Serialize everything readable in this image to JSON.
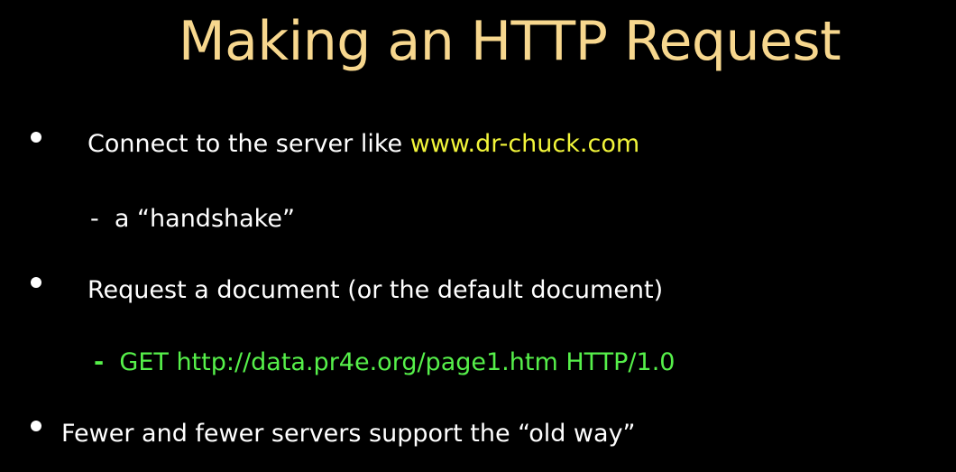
{
  "colors": {
    "background": "#000000",
    "title": "#f7d78e",
    "text": "#ffffff",
    "link": "#f2f53a",
    "code": "#56f04a"
  },
  "slide": {
    "title": "Making an HTTP Request",
    "bullet1": {
      "text": "Connect to the server like ",
      "link": "www.dr-chuck.com"
    },
    "sub1": {
      "dash": "-",
      "text": "a “handshake”"
    },
    "bullet2": {
      "text": "Request a document (or the default document)"
    },
    "sub2": {
      "dash": "-",
      "text": "GET http://data.pr4e.org/page1.htm HTTP/1.0"
    },
    "bullet3": {
      "text": "Fewer and fewer servers support the “old way”"
    }
  }
}
